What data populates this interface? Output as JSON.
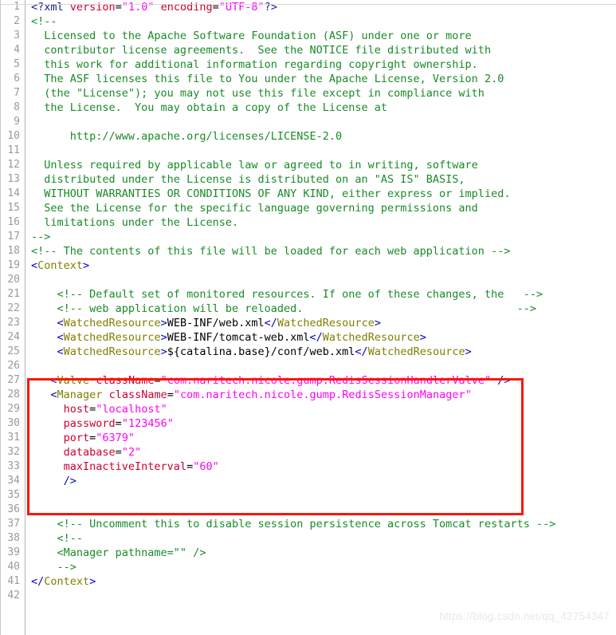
{
  "editor": {
    "language": "xml",
    "file_kind": "tomcat-context-xml",
    "gutter_first_line": 1,
    "gutter_last_line": 42,
    "background_color": "#ffffff",
    "gutter_text_color": "#9a9a9a",
    "colors": {
      "punctuation": "#0000c8",
      "tag_name": "#7f7f00",
      "attribute_name": "#cc0033",
      "attribute_value": "#ff00ff",
      "comment": "#1a8a28",
      "processing_instruction": "#1a1a8c",
      "text": "#000000",
      "highlight_rectangle": "#fb1606"
    }
  },
  "clipped_top_line": {
    "text": "                                                                       "
  },
  "highlight_box": {
    "label": "red-annotation-rectangle",
    "covers_lines": "27-35",
    "color": "#fb1606"
  },
  "watermark": {
    "text": "https://blog.csdn.net/qq_42754347"
  },
  "lines": [
    {
      "n": "1",
      "tokens": [
        {
          "c": "t-pi",
          "t": "<?xml "
        },
        {
          "c": "t-attr",
          "t": "version"
        },
        {
          "c": "t-eq",
          "t": "="
        },
        {
          "c": "t-val",
          "t": "\"1.0\""
        },
        {
          "c": "t-eq",
          "t": " "
        },
        {
          "c": "t-attr",
          "t": "encoding"
        },
        {
          "c": "t-eq",
          "t": "="
        },
        {
          "c": "t-val",
          "t": "\"UTF-8\""
        },
        {
          "c": "t-pi",
          "t": "?>"
        }
      ]
    },
    {
      "n": "2",
      "tokens": [
        {
          "c": "t-comment",
          "t": "<!--"
        }
      ]
    },
    {
      "n": "3",
      "tokens": [
        {
          "c": "t-comment",
          "t": "  Licensed to the Apache Software Foundation (ASF) under one or more"
        }
      ]
    },
    {
      "n": "4",
      "tokens": [
        {
          "c": "t-comment",
          "t": "  contributor license agreements.  See the NOTICE file distributed with"
        }
      ]
    },
    {
      "n": "5",
      "tokens": [
        {
          "c": "t-comment",
          "t": "  this work for additional information regarding copyright ownership."
        }
      ]
    },
    {
      "n": "6",
      "tokens": [
        {
          "c": "t-comment",
          "t": "  The ASF licenses this file to You under the Apache License, Version 2.0"
        }
      ]
    },
    {
      "n": "7",
      "tokens": [
        {
          "c": "t-comment",
          "t": "  (the \"License\"); you may not use this file except in compliance with"
        }
      ]
    },
    {
      "n": "8",
      "tokens": [
        {
          "c": "t-comment",
          "t": "  the License.  You may obtain a copy of the License at"
        }
      ]
    },
    {
      "n": "9",
      "tokens": []
    },
    {
      "n": "10",
      "tokens": [
        {
          "c": "t-comment",
          "t": "      http://www.apache.org/licenses/LICENSE-2.0"
        }
      ]
    },
    {
      "n": "11",
      "tokens": []
    },
    {
      "n": "12",
      "tokens": [
        {
          "c": "t-comment",
          "t": "  Unless required by applicable law or agreed to in writing, software"
        }
      ]
    },
    {
      "n": "13",
      "tokens": [
        {
          "c": "t-comment",
          "t": "  distributed under the License is distributed on an \"AS IS\" BASIS,"
        }
      ]
    },
    {
      "n": "14",
      "tokens": [
        {
          "c": "t-comment",
          "t": "  WITHOUT WARRANTIES OR CONDITIONS OF ANY KIND, either express or implied."
        }
      ]
    },
    {
      "n": "15",
      "tokens": [
        {
          "c": "t-comment",
          "t": "  See the License for the specific language governing permissions and"
        }
      ]
    },
    {
      "n": "16",
      "tokens": [
        {
          "c": "t-comment",
          "t": "  limitations under the License."
        }
      ]
    },
    {
      "n": "17",
      "tokens": [
        {
          "c": "t-comment",
          "t": "-->"
        }
      ]
    },
    {
      "n": "18",
      "tokens": [
        {
          "c": "t-comment",
          "t": "<!-- The contents of this file will be loaded for each web application -->"
        }
      ]
    },
    {
      "n": "19",
      "tokens": [
        {
          "c": "t-punct",
          "t": "<"
        },
        {
          "c": "t-tag",
          "t": "Context"
        },
        {
          "c": "t-punct",
          "t": ">"
        }
      ]
    },
    {
      "n": "20",
      "tokens": []
    },
    {
      "n": "21",
      "tokens": [
        {
          "c": "t-comment",
          "t": "    <!-- Default set of monitored resources. If one of these changes, the   -->"
        }
      ]
    },
    {
      "n": "22",
      "tokens": [
        {
          "c": "t-comment",
          "t": "    <!-- web application will be reloaded.                                 -->"
        }
      ]
    },
    {
      "n": "23",
      "tokens": [
        {
          "c": "t-eq",
          "t": "    "
        },
        {
          "c": "t-punct",
          "t": "<"
        },
        {
          "c": "t-tag",
          "t": "WatchedResource"
        },
        {
          "c": "t-punct",
          "t": ">"
        },
        {
          "c": "t-text",
          "t": "WEB-INF/web.xml"
        },
        {
          "c": "t-punct",
          "t": "</"
        },
        {
          "c": "t-tag",
          "t": "WatchedResource"
        },
        {
          "c": "t-punct",
          "t": ">"
        }
      ]
    },
    {
      "n": "24",
      "tokens": [
        {
          "c": "t-eq",
          "t": "    "
        },
        {
          "c": "t-punct",
          "t": "<"
        },
        {
          "c": "t-tag",
          "t": "WatchedResource"
        },
        {
          "c": "t-punct",
          "t": ">"
        },
        {
          "c": "t-text",
          "t": "WEB-INF/tomcat-web.xml"
        },
        {
          "c": "t-punct",
          "t": "</"
        },
        {
          "c": "t-tag",
          "t": "WatchedResource"
        },
        {
          "c": "t-punct",
          "t": ">"
        }
      ]
    },
    {
      "n": "25",
      "tokens": [
        {
          "c": "t-eq",
          "t": "    "
        },
        {
          "c": "t-punct",
          "t": "<"
        },
        {
          "c": "t-tag",
          "t": "WatchedResource"
        },
        {
          "c": "t-punct",
          "t": ">"
        },
        {
          "c": "t-text",
          "t": "${catalina.base}/conf/web.xml"
        },
        {
          "c": "t-punct",
          "t": "</"
        },
        {
          "c": "t-tag",
          "t": "WatchedResource"
        },
        {
          "c": "t-punct",
          "t": ">"
        }
      ]
    },
    {
      "n": "26",
      "tokens": []
    },
    {
      "n": "27",
      "tokens": [
        {
          "c": "t-eq",
          "t": "   "
        },
        {
          "c": "t-punct",
          "t": "<"
        },
        {
          "c": "t-tag",
          "t": "Valve"
        },
        {
          "c": "t-eq",
          "t": " "
        },
        {
          "c": "t-attr",
          "t": "className"
        },
        {
          "c": "t-eq",
          "t": "="
        },
        {
          "c": "t-val",
          "t": "\"com.naritech.nicole.gump.RedisSessionHandlerValve\""
        },
        {
          "c": "t-eq",
          "t": " "
        },
        {
          "c": "t-punct",
          "t": "/>"
        }
      ]
    },
    {
      "n": "28",
      "tokens": [
        {
          "c": "t-eq",
          "t": "   "
        },
        {
          "c": "t-punct",
          "t": "<"
        },
        {
          "c": "t-tag",
          "t": "Manager"
        },
        {
          "c": "t-eq",
          "t": " "
        },
        {
          "c": "t-attr",
          "t": "className"
        },
        {
          "c": "t-eq",
          "t": "="
        },
        {
          "c": "t-val",
          "t": "\"com.naritech.nicole.gump.RedisSessionManager\""
        }
      ]
    },
    {
      "n": "29",
      "tokens": [
        {
          "c": "t-eq",
          "t": "     "
        },
        {
          "c": "t-attr",
          "t": "host"
        },
        {
          "c": "t-eq",
          "t": "="
        },
        {
          "c": "t-val",
          "t": "\"localhost\""
        }
      ]
    },
    {
      "n": "30",
      "tokens": [
        {
          "c": "t-eq",
          "t": "     "
        },
        {
          "c": "t-attr",
          "t": "password"
        },
        {
          "c": "t-eq",
          "t": "="
        },
        {
          "c": "t-val",
          "t": "\"123456\""
        }
      ]
    },
    {
      "n": "31",
      "tokens": [
        {
          "c": "t-eq",
          "t": "     "
        },
        {
          "c": "t-attr",
          "t": "port"
        },
        {
          "c": "t-eq",
          "t": "="
        },
        {
          "c": "t-val",
          "t": "\"6379\""
        }
      ]
    },
    {
      "n": "32",
      "tokens": [
        {
          "c": "t-eq",
          "t": "     "
        },
        {
          "c": "t-attr",
          "t": "database"
        },
        {
          "c": "t-eq",
          "t": "="
        },
        {
          "c": "t-val",
          "t": "\"2\""
        }
      ]
    },
    {
      "n": "33",
      "tokens": [
        {
          "c": "t-eq",
          "t": "     "
        },
        {
          "c": "t-attr",
          "t": "maxInactiveInterval"
        },
        {
          "c": "t-eq",
          "t": "="
        },
        {
          "c": "t-val",
          "t": "\"60\""
        }
      ]
    },
    {
      "n": "34",
      "tokens": [
        {
          "c": "t-eq",
          "t": "     "
        },
        {
          "c": "t-punct",
          "t": "/>"
        }
      ]
    },
    {
      "n": "35",
      "tokens": []
    },
    {
      "n": "36",
      "tokens": []
    },
    {
      "n": "37",
      "tokens": [
        {
          "c": "t-comment",
          "t": "    <!-- Uncomment this to disable session persistence across Tomcat restarts -->"
        }
      ]
    },
    {
      "n": "38",
      "tokens": [
        {
          "c": "t-comment",
          "t": "    <!--"
        }
      ]
    },
    {
      "n": "39",
      "tokens": [
        {
          "c": "t-comment",
          "t": "    <Manager pathname=\"\" />"
        }
      ]
    },
    {
      "n": "40",
      "tokens": [
        {
          "c": "t-comment",
          "t": "    -->"
        }
      ]
    },
    {
      "n": "41",
      "tokens": [
        {
          "c": "t-punct",
          "t": "</"
        },
        {
          "c": "t-tag",
          "t": "Context"
        },
        {
          "c": "t-punct",
          "t": ">"
        }
      ]
    },
    {
      "n": "42",
      "tokens": []
    }
  ]
}
